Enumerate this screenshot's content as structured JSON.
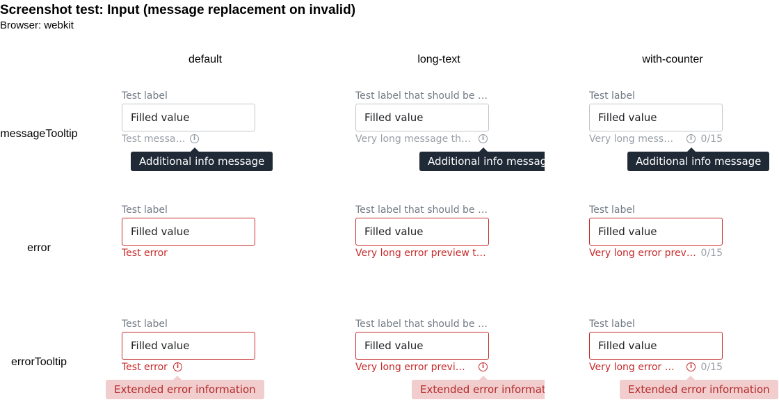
{
  "page": {
    "title": "Screenshot test: Input (message replacement on invalid)",
    "browser": "Browser: webkit"
  },
  "columns": [
    "default",
    "long-text",
    "with-counter"
  ],
  "rows": [
    "messageTooltip",
    "error",
    "errorTooltip"
  ],
  "fields": {
    "value": "Filled value",
    "short_label": "Test label",
    "long_label": "Test label that should be t…",
    "counter": "0/15"
  },
  "messageTooltip": {
    "default_message": "Test message",
    "long_message": "Very long message tha…",
    "counter_message": "Very long messa…",
    "tooltip": "Additional info message"
  },
  "error": {
    "default_message": "Test error",
    "long_message": "Very long error preview th…",
    "counter_message": "Very long error previ…"
  },
  "errorTooltip": {
    "default_message": "Test error",
    "long_message": "Very long error previe…",
    "counter_message": "Very long error p…",
    "tooltip": "Extended error information"
  },
  "icons": {
    "info": "info-icon"
  },
  "colors": {
    "error": "#c62b2b",
    "tooltip_dark": "#1f2a36",
    "tooltip_error_bg": "#f1cdcd",
    "label_gray": "#727a84"
  }
}
